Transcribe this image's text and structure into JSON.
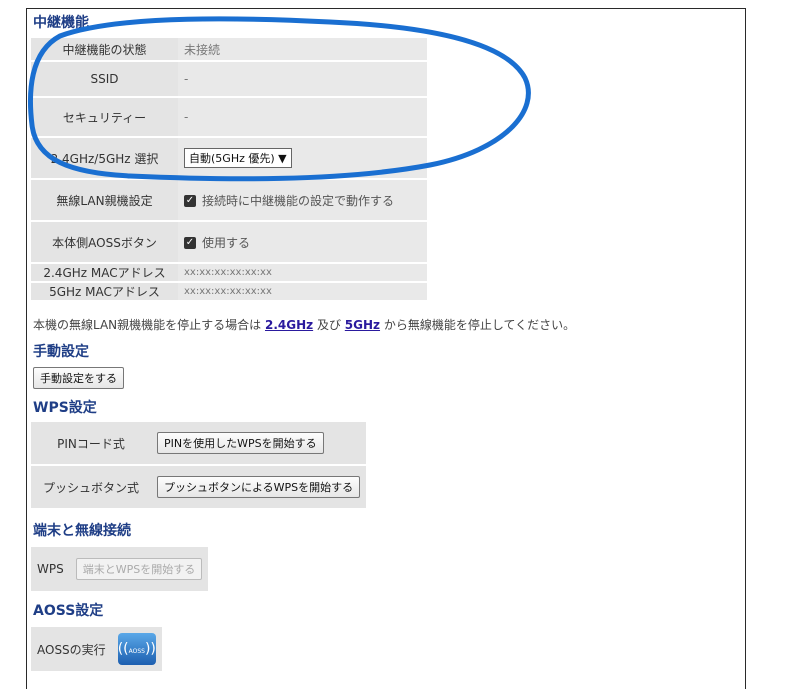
{
  "relay": {
    "heading": "中継機能",
    "rows": [
      {
        "label": "中継機能の状態",
        "value": "未接続"
      },
      {
        "label": "SSID",
        "value": "-"
      },
      {
        "label": "セキュリティー",
        "value": "-"
      },
      {
        "label": "2.4GHz/5GHz 選択",
        "select": "自動(5GHz 優先)"
      },
      {
        "label": "無線LAN親機設定",
        "checkbox": "接続時に中継機能の設定で動作する"
      },
      {
        "label": "本体側AOSSボタン",
        "checkbox": "使用する"
      },
      {
        "label": "2.4GHz MACアドレス",
        "value": "xx:xx:xx:xx:xx:xx"
      },
      {
        "label": "5GHz MACアドレス",
        "value": "xx:xx:xx:xx:xx:xx"
      }
    ]
  },
  "note": {
    "prefix": "本機の無線LAN親機機能を停止する場合は",
    "link1": "2.4GHz",
    "middle": "及び",
    "link2": "5GHz",
    "suffix": "から無線機能を停止してください。"
  },
  "manual": {
    "heading": "手動設定",
    "button": "手動設定をする"
  },
  "wps": {
    "heading": "WPS設定",
    "pin_label": "PINコード式",
    "pin_button": "PINを使用したWPSを開始する",
    "push_label": "プッシュボタン式",
    "push_button": "プッシュボタンによるWPSを開始する"
  },
  "terminal": {
    "heading": "端末と無線接続",
    "label": "WPS",
    "button": "端末とWPSを開始する"
  },
  "aoss": {
    "heading": "AOSS設定",
    "label": "AOSSの実行",
    "icon_text": "AOSS"
  },
  "annotation": {
    "color": "#1a6fd1"
  }
}
